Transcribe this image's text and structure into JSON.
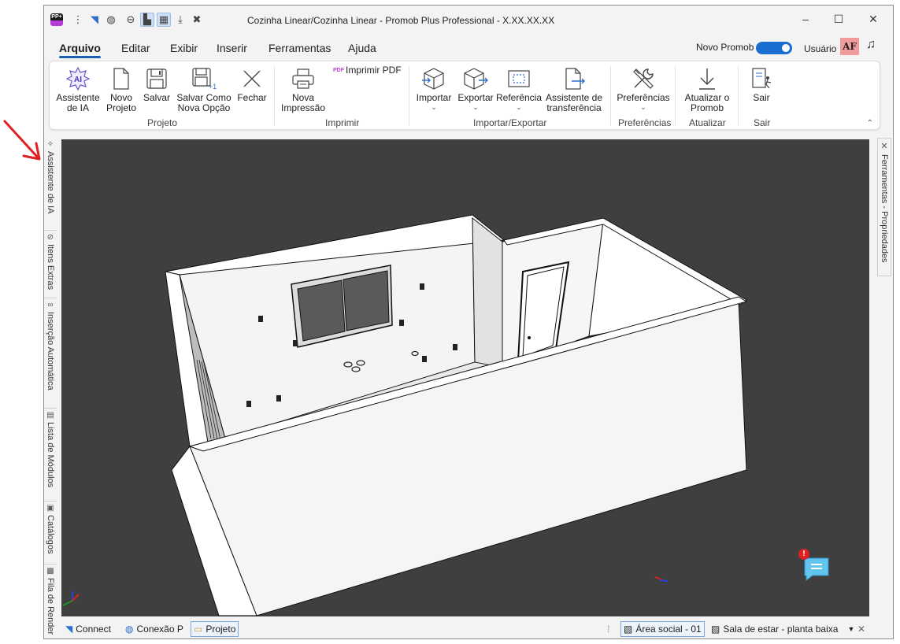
{
  "window": {
    "title": "Cozinha Linear/Cozinha Linear - Promob Plus Professional - X.XX.XX.XX",
    "app_icon_text": "PP+"
  },
  "menu": {
    "items": [
      "Arquivo",
      "Editar",
      "Exibir",
      "Inserir",
      "Ferramentas",
      "Ajuda"
    ],
    "active": "Arquivo",
    "novo_promob_label": "Novo Promob",
    "novo_promob_enabled": true,
    "user_label": "Usuário",
    "avatar_initials": "AF"
  },
  "ribbon": {
    "groups": {
      "projeto": "Projeto",
      "imprimir": "Imprimir",
      "importar_exportar": "Importar/Exportar",
      "preferencias": "Preferências",
      "atualizar": "Atualizar",
      "sair": "Sair"
    },
    "buttons": {
      "assistente_ia_1": "Assistente",
      "assistente_ia_2": "de IA",
      "assistente_ia_icon": "AI",
      "novo_projeto_1": "Novo",
      "novo_projeto_2": "Projeto",
      "salvar": "Salvar",
      "salvar_como_1": "Salvar Como",
      "salvar_como_2": "Nova Opção",
      "fechar": "Fechar",
      "nova_impressao_1": "Nova",
      "nova_impressao_2": "Impressão",
      "imprimir_pdf": "Imprimir PDF",
      "pdf_tag": "PDF",
      "importar": "Importar",
      "exportar": "Exportar",
      "referencia": "Referência",
      "assistente_transf_1": "Assistente de",
      "assistente_transf_2": "transferência",
      "preferencias": "Preferências",
      "atualizar_1": "Atualizar o",
      "atualizar_2": "Promob",
      "sair": "Sair"
    }
  },
  "left_tabs": [
    "Assistente de IA",
    "Itens Extras",
    "Inserção Automática",
    "Lista de Módulos",
    "Catálogos",
    "Fila de Render"
  ],
  "right_tab": "Ferramentas - Propriedades",
  "statusbar": {
    "connect": "Connect",
    "conexao": "Conexão P",
    "projeto": "Projeto",
    "area": "Área social - 01",
    "sala": "Sala de estar - planta baixa"
  },
  "notification_badge": "!",
  "colors": {
    "accent": "#1a6fd1",
    "viewport_bg": "#3f3f3f",
    "avatar_bg": "#f29b9b",
    "annotation": "#e02020"
  }
}
